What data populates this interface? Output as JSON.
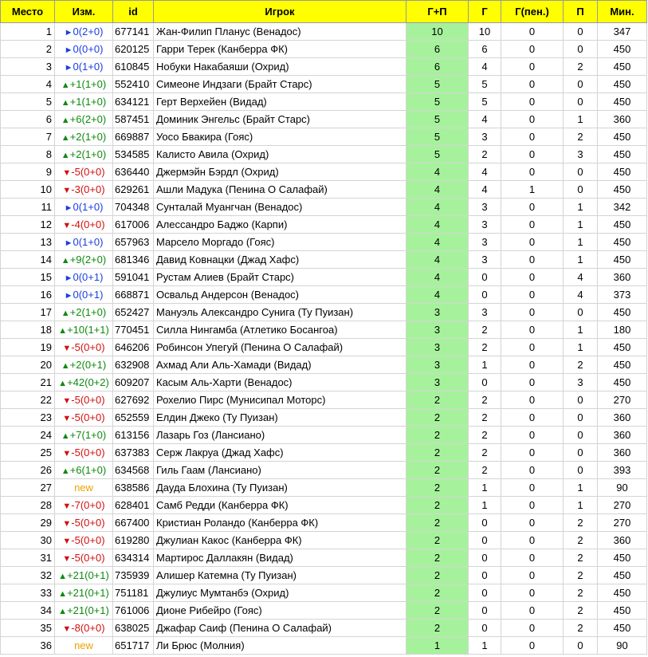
{
  "headers": {
    "rank": "Место",
    "change": "Изм.",
    "id": "id",
    "player": "Игрок",
    "gp": "Г+П",
    "g": "Г",
    "gpen": "Г(пен.)",
    "p": "П",
    "min": "Мин."
  },
  "rows": [
    {
      "rank": "1",
      "arrow": "►",
      "change": "0(2+0)",
      "type": "same",
      "id": "677141",
      "player": "Жан-Филип Планус (Венадос)",
      "gp": "10",
      "g": "10",
      "gpen": "0",
      "p": "0",
      "min": "347"
    },
    {
      "rank": "2",
      "arrow": "►",
      "change": "0(0+0)",
      "type": "same",
      "id": "620125",
      "player": "Гарри Терек (Канберра ФК)",
      "gp": "6",
      "g": "6",
      "gpen": "0",
      "p": "0",
      "min": "450"
    },
    {
      "rank": "3",
      "arrow": "►",
      "change": "0(1+0)",
      "type": "same",
      "id": "610845",
      "player": "Нобуки Накабаяши (Охрид)",
      "gp": "6",
      "g": "4",
      "gpen": "0",
      "p": "2",
      "min": "450"
    },
    {
      "rank": "4",
      "arrow": "▲",
      "change": "+1(1+0)",
      "type": "up",
      "id": "552410",
      "player": "Симеоне Индзаги (Брайт Старс)",
      "gp": "5",
      "g": "5",
      "gpen": "0",
      "p": "0",
      "min": "450"
    },
    {
      "rank": "5",
      "arrow": "▲",
      "change": "+1(1+0)",
      "type": "up",
      "id": "634121",
      "player": "Герт Верхейен (Видад)",
      "gp": "5",
      "g": "5",
      "gpen": "0",
      "p": "0",
      "min": "450"
    },
    {
      "rank": "6",
      "arrow": "▲",
      "change": "+6(2+0)",
      "type": "up",
      "id": "587451",
      "player": "Доминик Энгельс (Брайт Старс)",
      "gp": "5",
      "g": "4",
      "gpen": "0",
      "p": "1",
      "min": "360"
    },
    {
      "rank": "7",
      "arrow": "▲",
      "change": "+2(1+0)",
      "type": "up",
      "id": "669887",
      "player": "Уосо Бвакира (Гояс)",
      "gp": "5",
      "g": "3",
      "gpen": "0",
      "p": "2",
      "min": "450"
    },
    {
      "rank": "8",
      "arrow": "▲",
      "change": "+2(1+0)",
      "type": "up",
      "id": "534585",
      "player": "Калисто Авила (Охрид)",
      "gp": "5",
      "g": "2",
      "gpen": "0",
      "p": "3",
      "min": "450"
    },
    {
      "rank": "9",
      "arrow": "▼",
      "change": "-5(0+0)",
      "type": "down",
      "id": "636440",
      "player": "Джермэйн Бэрдл (Охрид)",
      "gp": "4",
      "g": "4",
      "gpen": "0",
      "p": "0",
      "min": "450"
    },
    {
      "rank": "10",
      "arrow": "▼",
      "change": "-3(0+0)",
      "type": "down",
      "id": "629261",
      "player": "Ашли Мадука (Пенина О Салафай)",
      "gp": "4",
      "g": "4",
      "gpen": "1",
      "p": "0",
      "min": "450"
    },
    {
      "rank": "11",
      "arrow": "►",
      "change": "0(1+0)",
      "type": "same",
      "id": "704348",
      "player": "Сунталай Муангчан (Венадос)",
      "gp": "4",
      "g": "3",
      "gpen": "0",
      "p": "1",
      "min": "342"
    },
    {
      "rank": "12",
      "arrow": "▼",
      "change": "-4(0+0)",
      "type": "down",
      "id": "617006",
      "player": "Алессандро Баджо (Карпи)",
      "gp": "4",
      "g": "3",
      "gpen": "0",
      "p": "1",
      "min": "450"
    },
    {
      "rank": "13",
      "arrow": "►",
      "change": "0(1+0)",
      "type": "same",
      "id": "657963",
      "player": "Марсело Моргадо (Гояс)",
      "gp": "4",
      "g": "3",
      "gpen": "0",
      "p": "1",
      "min": "450"
    },
    {
      "rank": "14",
      "arrow": "▲",
      "change": "+9(2+0)",
      "type": "up",
      "id": "681346",
      "player": "Давид Ковнацки (Джад Хафс)",
      "gp": "4",
      "g": "3",
      "gpen": "0",
      "p": "1",
      "min": "450"
    },
    {
      "rank": "15",
      "arrow": "►",
      "change": "0(0+1)",
      "type": "same",
      "id": "591041",
      "player": "Рустам Алиев (Брайт Старс)",
      "gp": "4",
      "g": "0",
      "gpen": "0",
      "p": "4",
      "min": "360"
    },
    {
      "rank": "16",
      "arrow": "►",
      "change": "0(0+1)",
      "type": "same",
      "id": "668871",
      "player": "Освальд Андерсон (Венадос)",
      "gp": "4",
      "g": "0",
      "gpen": "0",
      "p": "4",
      "min": "373"
    },
    {
      "rank": "17",
      "arrow": "▲",
      "change": "+2(1+0)",
      "type": "up",
      "id": "652427",
      "player": "Мануэль Александро Сунига (Ту Пуизан)",
      "gp": "3",
      "g": "3",
      "gpen": "0",
      "p": "0",
      "min": "450"
    },
    {
      "rank": "18",
      "arrow": "▲",
      "change": "+10(1+1)",
      "type": "up",
      "id": "770451",
      "player": "Силла Нингамба (Атлетико Босангоа)",
      "gp": "3",
      "g": "2",
      "gpen": "0",
      "p": "1",
      "min": "180"
    },
    {
      "rank": "19",
      "arrow": "▼",
      "change": "-5(0+0)",
      "type": "down",
      "id": "646206",
      "player": "Робинсон Упегуй (Пенина О Салафай)",
      "gp": "3",
      "g": "2",
      "gpen": "0",
      "p": "1",
      "min": "450"
    },
    {
      "rank": "20",
      "arrow": "▲",
      "change": "+2(0+1)",
      "type": "up",
      "id": "632908",
      "player": "Ахмад Али Аль-Хамади (Видад)",
      "gp": "3",
      "g": "1",
      "gpen": "0",
      "p": "2",
      "min": "450"
    },
    {
      "rank": "21",
      "arrow": "▲",
      "change": "+42(0+2)",
      "type": "up",
      "id": "609207",
      "player": "Касым Аль-Харти (Венадос)",
      "gp": "3",
      "g": "0",
      "gpen": "0",
      "p": "3",
      "min": "450"
    },
    {
      "rank": "22",
      "arrow": "▼",
      "change": "-5(0+0)",
      "type": "down",
      "id": "627692",
      "player": "Рохелио Пирс (Мунисипал Моторс)",
      "gp": "2",
      "g": "2",
      "gpen": "0",
      "p": "0",
      "min": "270"
    },
    {
      "rank": "23",
      "arrow": "▼",
      "change": "-5(0+0)",
      "type": "down",
      "id": "652559",
      "player": "Елдин Джеко (Ту Пуизан)",
      "gp": "2",
      "g": "2",
      "gpen": "0",
      "p": "0",
      "min": "360"
    },
    {
      "rank": "24",
      "arrow": "▲",
      "change": "+7(1+0)",
      "type": "up",
      "id": "613156",
      "player": "Лазарь Гоз (Лансиано)",
      "gp": "2",
      "g": "2",
      "gpen": "0",
      "p": "0",
      "min": "360"
    },
    {
      "rank": "25",
      "arrow": "▼",
      "change": "-5(0+0)",
      "type": "down",
      "id": "637383",
      "player": "Серж Лакруа (Джад Хафс)",
      "gp": "2",
      "g": "2",
      "gpen": "0",
      "p": "0",
      "min": "360"
    },
    {
      "rank": "26",
      "arrow": "▲",
      "change": "+6(1+0)",
      "type": "up",
      "id": "634568",
      "player": "Гиль Гаам (Лансиано)",
      "gp": "2",
      "g": "2",
      "gpen": "0",
      "p": "0",
      "min": "393"
    },
    {
      "rank": "27",
      "arrow": "",
      "change": "new",
      "type": "new",
      "id": "638586",
      "player": "Дауда Блохина (Ту Пуизан)",
      "gp": "2",
      "g": "1",
      "gpen": "0",
      "p": "1",
      "min": "90"
    },
    {
      "rank": "28",
      "arrow": "▼",
      "change": "-7(0+0)",
      "type": "down",
      "id": "628401",
      "player": "Самб Редди (Канберра ФК)",
      "gp": "2",
      "g": "1",
      "gpen": "0",
      "p": "1",
      "min": "270"
    },
    {
      "rank": "29",
      "arrow": "▼",
      "change": "-5(0+0)",
      "type": "down",
      "id": "667400",
      "player": "Кристиан Роландо (Канберра ФК)",
      "gp": "2",
      "g": "0",
      "gpen": "0",
      "p": "2",
      "min": "270"
    },
    {
      "rank": "30",
      "arrow": "▼",
      "change": "-5(0+0)",
      "type": "down",
      "id": "619280",
      "player": "Джулиан Какос (Канберра ФК)",
      "gp": "2",
      "g": "0",
      "gpen": "0",
      "p": "2",
      "min": "360"
    },
    {
      "rank": "31",
      "arrow": "▼",
      "change": "-5(0+0)",
      "type": "down",
      "id": "634314",
      "player": "Мартирос Даллакян (Видад)",
      "gp": "2",
      "g": "0",
      "gpen": "0",
      "p": "2",
      "min": "450"
    },
    {
      "rank": "32",
      "arrow": "▲",
      "change": "+21(0+1)",
      "type": "up",
      "id": "735939",
      "player": "Алишер Катемна (Ту Пуизан)",
      "gp": "2",
      "g": "0",
      "gpen": "0",
      "p": "2",
      "min": "450"
    },
    {
      "rank": "33",
      "arrow": "▲",
      "change": "+21(0+1)",
      "type": "up",
      "id": "751181",
      "player": "Джулиус Мумтанбэ (Охрид)",
      "gp": "2",
      "g": "0",
      "gpen": "0",
      "p": "2",
      "min": "450"
    },
    {
      "rank": "34",
      "arrow": "▲",
      "change": "+21(0+1)",
      "type": "up",
      "id": "761006",
      "player": "Дионе Рибейро (Гояс)",
      "gp": "2",
      "g": "0",
      "gpen": "0",
      "p": "2",
      "min": "450"
    },
    {
      "rank": "35",
      "arrow": "▼",
      "change": "-8(0+0)",
      "type": "down",
      "id": "638025",
      "player": "Джафар Саиф (Пенина О Салафай)",
      "gp": "2",
      "g": "0",
      "gpen": "0",
      "p": "2",
      "min": "450"
    },
    {
      "rank": "36",
      "arrow": "",
      "change": "new",
      "type": "new",
      "id": "651717",
      "player": "Ли Брюс (Молния)",
      "gp": "1",
      "g": "1",
      "gpen": "0",
      "p": "0",
      "min": "90"
    }
  ]
}
